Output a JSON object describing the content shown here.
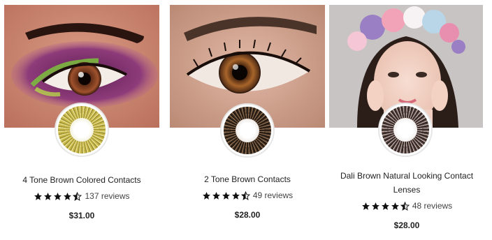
{
  "products": [
    {
      "title": "4 Tone Brown Colored Contacts",
      "rating": 4.5,
      "reviews": "137 reviews",
      "price": "$31.00"
    },
    {
      "title": "2 Tone Brown Contacts",
      "rating": 4.5,
      "reviews": "49 reviews",
      "price": "$28.00"
    },
    {
      "title": "Dali Brown Natural Looking Contact Lenses",
      "rating": 4.5,
      "reviews": "48 reviews",
      "price": "$28.00"
    }
  ],
  "colors": {
    "star": "#111111",
    "text": "#222222"
  }
}
